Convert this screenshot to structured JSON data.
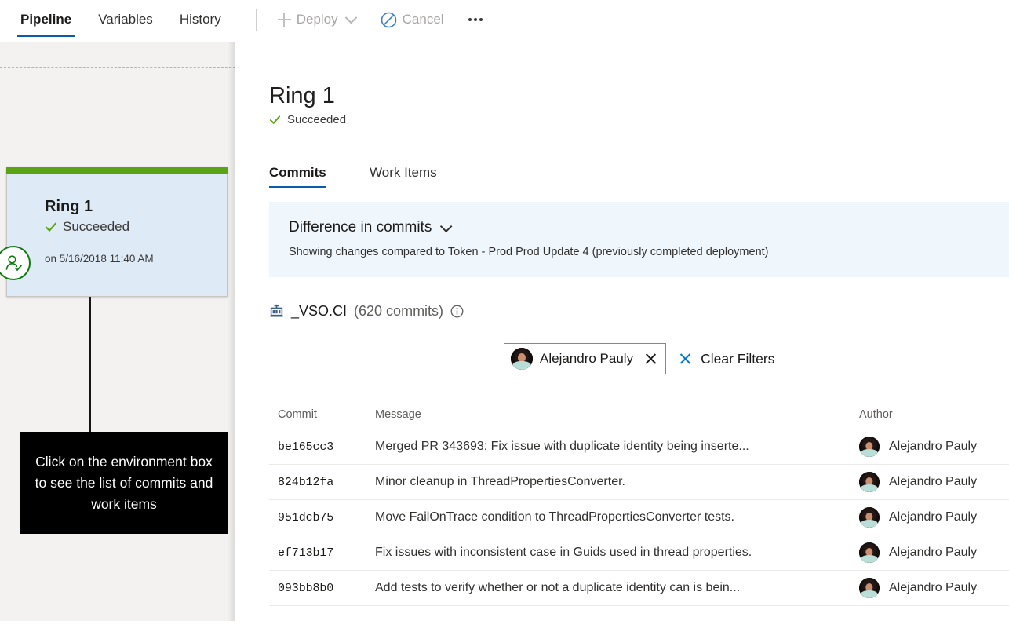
{
  "commandbar": {
    "pivots": [
      {
        "label": "Pipeline",
        "selected": true
      },
      {
        "label": "Variables",
        "selected": false
      },
      {
        "label": "History",
        "selected": false
      }
    ],
    "deploy_label": "Deploy",
    "cancel_label": "Cancel",
    "overflow_label": "...",
    "deploy_icon": "plus-icon",
    "deploy_chevron_icon": "chevron-down-icon",
    "cancel_icon": "cancel-circle-icon"
  },
  "pipeline_canvas": {
    "environment": {
      "name": "Ring 1",
      "status": "Succeeded",
      "timestamp": "on 5/16/2018 11:40 AM",
      "status_icon": "checkmark-icon",
      "badge_icon": "approval-person-icon",
      "top_bar_color": "#5aa314",
      "background_color": "#deeaf6"
    },
    "callout": {
      "text": "Click on the environment box to see the list of commits and work items"
    }
  },
  "detail": {
    "title": "Ring 1",
    "status": "Succeeded",
    "status_icon": "checkmark-icon",
    "tabs": [
      {
        "label": "Commits",
        "selected": true
      },
      {
        "label": "Work Items",
        "selected": false
      }
    ],
    "difference_banner": {
      "title": "Difference in commits",
      "chevron_icon": "chevron-down-icon",
      "subtitle": "Showing changes compared to Token - Prod Prod Update 4 (previously completed deployment)",
      "background_color": "#eff6fc"
    },
    "repository": {
      "icon": "build-artifact-icon",
      "name": "_VSO.CI",
      "count_label": "(620 commits)",
      "info_icon": "info-icon"
    },
    "filters": {
      "chip": {
        "avatar_icon": "user-avatar",
        "name": "Alejandro Pauly",
        "remove_icon": "close-icon"
      },
      "clear_filters_label": "Clear Filters",
      "clear_filters_icon": "close-icon"
    },
    "commits_table": {
      "columns": [
        "Commit",
        "Message",
        "Author"
      ],
      "rows": [
        {
          "commit": "be165cc3",
          "message": "Merged PR 343693: Fix issue with duplicate identity being inserte...",
          "author": "Alejandro Pauly"
        },
        {
          "commit": "824b12fa",
          "message": "Minor cleanup in ThreadPropertiesConverter.",
          "author": "Alejandro Pauly"
        },
        {
          "commit": "951dcb75",
          "message": "Move FailOnTrace condition to ThreadPropertiesConverter tests.",
          "author": "Alejandro Pauly"
        },
        {
          "commit": "ef713b17",
          "message": "Fix issues with inconsistent case in Guids used in thread properties.",
          "author": "Alejandro Pauly"
        },
        {
          "commit": "093bb8b0",
          "message": "Add tests to verify whether or not a duplicate identity can is bein...",
          "author": "Alejandro Pauly"
        }
      ]
    }
  },
  "colors": {
    "accent_blue": "#0b5cab",
    "link_blue": "#0078d4",
    "success_green": "#107c10",
    "banner_blue": "#eff6fc",
    "canvas_gray": "#f3f2f1"
  }
}
